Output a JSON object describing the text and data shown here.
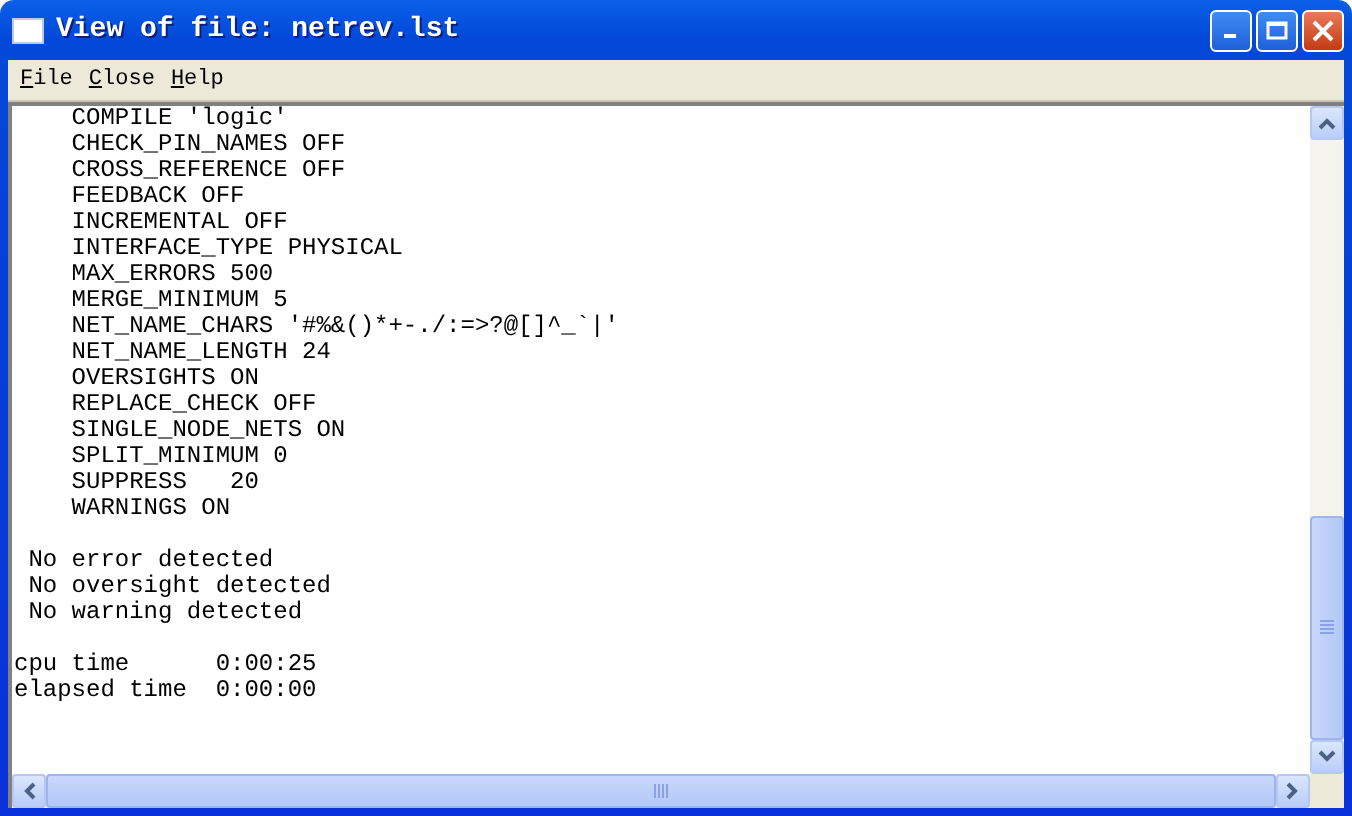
{
  "window": {
    "title": "View of file: netrev.lst"
  },
  "menu": [
    "File",
    "Close",
    "Help"
  ],
  "text_blocks": [
    {
      "lines": [
        "    COMPILE 'logic'",
        "    CHECK_PIN_NAMES OFF",
        "    CROSS_REFERENCE OFF",
        "    FEEDBACK OFF",
        "    INCREMENTAL OFF",
        "    INTERFACE_TYPE PHYSICAL",
        "    MAX_ERRORS 500",
        "    MERGE_MINIMUM 5",
        "    NET_NAME_CHARS '#%&()*+-./:=>?@[]^_`|'",
        "    NET_NAME_LENGTH 24",
        "    OVERSIGHTS ON",
        "    REPLACE_CHECK OFF",
        "    SINGLE_NODE_NETS ON",
        "    SPLIT_MINIMUM 0",
        "    SUPPRESS   20",
        "    WARNINGS ON"
      ]
    },
    {
      "lines": [
        " No error detected",
        " No oversight detected",
        " No warning detected"
      ]
    },
    {
      "lines": [
        "cpu time      0:00:25",
        "elapsed time  0:00:00"
      ]
    }
  ]
}
